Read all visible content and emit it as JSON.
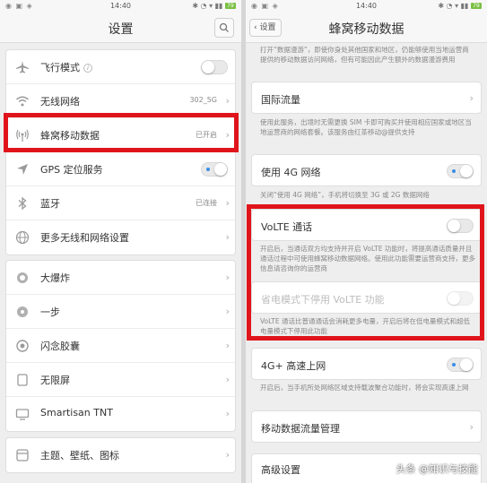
{
  "status": {
    "time": "14:40",
    "battery": "79"
  },
  "left": {
    "title": "设置",
    "group1": [
      {
        "label": "飞行模式",
        "toggle": "off"
      },
      {
        "label": "无线网络",
        "value": "302_5G"
      },
      {
        "label": "蜂窝移动数据",
        "value": "已开启"
      },
      {
        "label": "GPS 定位服务",
        "toggle": "on"
      },
      {
        "label": "蓝牙",
        "value": "已连接"
      },
      {
        "label": "更多无线和网络设置"
      }
    ],
    "group2": [
      {
        "label": "大爆炸"
      },
      {
        "label": "一步"
      },
      {
        "label": "闪念胶囊"
      },
      {
        "label": "无限屏"
      },
      {
        "label": "Smartisan TNT"
      }
    ],
    "group3": [
      {
        "label": "主题、壁纸、图标"
      }
    ]
  },
  "right": {
    "back_label": "设置",
    "title": "蜂窝移动数据",
    "top_note": "打开“数据漫游”，即使你身处其他国家和地区，仍能够使用当地运营商提供的移动数据访问网络，但有可能因此产生额外的数据漫游费用",
    "intl_label": "国际流量",
    "intl_note": "使用此服务，出境时无需更换 SIM 卡即可购买并使用相应国家或地区当地运营商的网络套餐。该服务由红茶移动@提供支持",
    "use4g_label": "使用 4G 网络",
    "use4g_note": "关闭“使用 4G 网络”，手机将切换至 3G 或 2G 数据网络",
    "volte_label": "VoLTE 通话",
    "volte_note": "开启后，当通话双方均支持并开启 VoLTE 功能时，将提高通话质量并且通话过程中可使用蜂窝移动数据网络。使用此功能需要运营商支持，更多信息请咨询你的运营商",
    "powersave_label": "省电模式下停用 VoLTE 功能",
    "powersave_note": "VoLTE 通话比普通通话会消耗更多电量，开启后将在低电量模式和超低电量模式下停用此功能",
    "4gplus_label": "4G+ 高速上网",
    "4gplus_note": "开启后，当手机所处网络区域支持载波聚合功能时，将会实现高速上网",
    "mgmt_label": "移动数据流量管理",
    "bottom_label": "高级设置"
  },
  "watermark": "头条 @知识与技能",
  "colors": {
    "highlight": "#e0141b",
    "toggle_on_dot": "#3a8ee6"
  }
}
